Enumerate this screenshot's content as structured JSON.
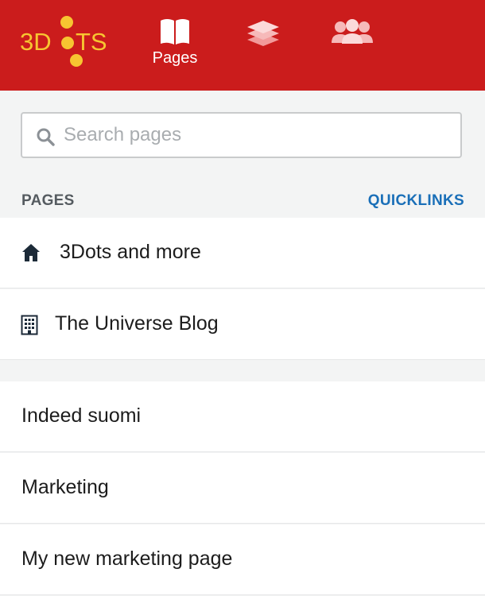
{
  "header": {
    "logo_text": "3DOTS",
    "nav": [
      {
        "label": "Pages",
        "icon": "book-icon"
      },
      {
        "label": "",
        "icon": "layers-icon"
      },
      {
        "label": "",
        "icon": "users-icon"
      }
    ]
  },
  "search": {
    "placeholder": "Search pages",
    "value": ""
  },
  "section": {
    "title": "PAGES",
    "quicklinks_label": "QUICKLINKS"
  },
  "quicklinks": [
    {
      "label": "3Dots and more",
      "icon": "home-icon"
    },
    {
      "label": "The Universe Blog",
      "icon": "building-icon"
    }
  ],
  "pages": [
    {
      "label": "Indeed suomi"
    },
    {
      "label": "Marketing"
    },
    {
      "label": "My new marketing page"
    }
  ],
  "colors": {
    "header_bg": "#cb1c1c",
    "logo": "#f7c531",
    "link": "#1a6fb8"
  }
}
